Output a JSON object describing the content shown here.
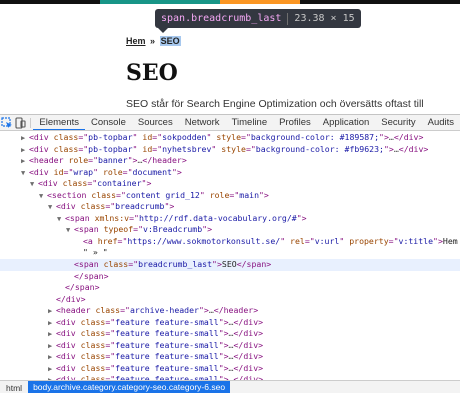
{
  "colors": {
    "topbar_podden": "#189587",
    "topbar_nyhetsbrev": "#fb9623",
    "selection": "#a7c8ee",
    "accent": "#1a73e8"
  },
  "tooltip": {
    "selector": "span.breadcrumb_last",
    "dims": "23.38 × 15"
  },
  "page": {
    "breadcrumb_home": "Hem",
    "breadcrumb_sep": "»",
    "breadcrumb_last": "SEO",
    "heading": "SEO",
    "intro": "SEO står för Search Engine Optimization och översätts oftast till"
  },
  "devtools": {
    "toolbar_icons": [
      "inspect-element-icon",
      "device-toolbar-icon"
    ],
    "tabs": [
      "Elements",
      "Console",
      "Sources",
      "Network",
      "Timeline",
      "Profiles",
      "Application",
      "Security",
      "Audits"
    ],
    "active_tab": "Elements",
    "dom_rows": [
      {
        "indent": 1,
        "tri": "▶",
        "tokens": [
          [
            "tag",
            "<div "
          ],
          [
            "attr",
            "class"
          ],
          [
            "tag",
            "=\""
          ],
          [
            "val",
            "pb-topbar"
          ],
          [
            "tag",
            "\" "
          ],
          [
            "attr",
            "id"
          ],
          [
            "tag",
            "=\""
          ],
          [
            "val",
            "sokpodden"
          ],
          [
            "tag",
            "\" "
          ],
          [
            "attr",
            "style"
          ],
          [
            "tag",
            "=\""
          ],
          [
            "val",
            "background-color: #189587;"
          ],
          [
            "tag",
            "\">"
          ],
          [
            "ell",
            "…"
          ],
          [
            "tag",
            "</div>"
          ]
        ]
      },
      {
        "indent": 1,
        "tri": "▶",
        "tokens": [
          [
            "tag",
            "<div "
          ],
          [
            "attr",
            "class"
          ],
          [
            "tag",
            "=\""
          ],
          [
            "val",
            "pb-topbar"
          ],
          [
            "tag",
            "\" "
          ],
          [
            "attr",
            "id"
          ],
          [
            "tag",
            "=\""
          ],
          [
            "val",
            "nyhetsbrev"
          ],
          [
            "tag",
            "\" "
          ],
          [
            "attr",
            "style"
          ],
          [
            "tag",
            "=\""
          ],
          [
            "val",
            "background-color: #fb9623;"
          ],
          [
            "tag",
            "\">"
          ],
          [
            "ell",
            "…"
          ],
          [
            "tag",
            "</div>"
          ]
        ]
      },
      {
        "indent": 1,
        "tri": "▶",
        "tokens": [
          [
            "tag",
            "<header "
          ],
          [
            "attr",
            "role"
          ],
          [
            "tag",
            "=\""
          ],
          [
            "val",
            "banner"
          ],
          [
            "tag",
            "\">"
          ],
          [
            "ell",
            "…"
          ],
          [
            "tag",
            "</header>"
          ]
        ]
      },
      {
        "indent": 1,
        "tri": "▼",
        "tokens": [
          [
            "tag",
            "<div "
          ],
          [
            "attr",
            "id"
          ],
          [
            "tag",
            "=\""
          ],
          [
            "val",
            "wrap"
          ],
          [
            "tag",
            "\" "
          ],
          [
            "attr",
            "role"
          ],
          [
            "tag",
            "=\""
          ],
          [
            "val",
            "document"
          ],
          [
            "tag",
            "\">"
          ]
        ]
      },
      {
        "indent": 2,
        "tri": "▼",
        "tokens": [
          [
            "tag",
            "<div "
          ],
          [
            "attr",
            "class"
          ],
          [
            "tag",
            "=\""
          ],
          [
            "val",
            "container"
          ],
          [
            "tag",
            "\">"
          ]
        ]
      },
      {
        "indent": 3,
        "tri": "▼",
        "tokens": [
          [
            "tag",
            "<section "
          ],
          [
            "attr",
            "class"
          ],
          [
            "tag",
            "=\""
          ],
          [
            "val",
            "content grid_12"
          ],
          [
            "tag",
            "\" "
          ],
          [
            "attr",
            "role"
          ],
          [
            "tag",
            "=\""
          ],
          [
            "val",
            "main"
          ],
          [
            "tag",
            "\">"
          ]
        ]
      },
      {
        "indent": 4,
        "tri": "▼",
        "tokens": [
          [
            "tag",
            "<div "
          ],
          [
            "attr",
            "class"
          ],
          [
            "tag",
            "=\""
          ],
          [
            "val",
            "breadcrumb"
          ],
          [
            "tag",
            "\">"
          ]
        ]
      },
      {
        "indent": 5,
        "tri": "▼",
        "tokens": [
          [
            "tag",
            "<span "
          ],
          [
            "attr",
            "xmlns:v"
          ],
          [
            "tag",
            "=\""
          ],
          [
            "val",
            "http://rdf.data-vocabulary.org/#"
          ],
          [
            "tag",
            "\">"
          ]
        ]
      },
      {
        "indent": 6,
        "tri": "▼",
        "tokens": [
          [
            "tag",
            "<span "
          ],
          [
            "attr",
            "typeof"
          ],
          [
            "tag",
            "=\""
          ],
          [
            "val",
            "v:Breadcrumb"
          ],
          [
            "tag",
            "\">"
          ]
        ]
      },
      {
        "indent": 7,
        "tri": "",
        "tokens": [
          [
            "tag",
            "<a "
          ],
          [
            "attr",
            "href"
          ],
          [
            "tag",
            "=\""
          ],
          [
            "val",
            "https://www.sokmotorkonsult.se/"
          ],
          [
            "tag",
            "\" "
          ],
          [
            "attr",
            "rel"
          ],
          [
            "tag",
            "=\""
          ],
          [
            "val",
            "v:url"
          ],
          [
            "tag",
            "\" "
          ],
          [
            "attr",
            "property"
          ],
          [
            "tag",
            "=\""
          ],
          [
            "val",
            "v:title"
          ],
          [
            "tag",
            "\">"
          ],
          [
            "txt",
            "Hem"
          ]
        ]
      },
      {
        "indent": 7,
        "tri": "",
        "tokens": [
          [
            "txt",
            "\" » \""
          ]
        ]
      },
      {
        "indent": 6,
        "tri": "",
        "selected": true,
        "tokens": [
          [
            "tag",
            "<span "
          ],
          [
            "attr",
            "class"
          ],
          [
            "tag",
            "=\""
          ],
          [
            "val",
            "breadcrumb_last"
          ],
          [
            "tag",
            "\">"
          ],
          [
            "txt",
            "SEO"
          ],
          [
            "tag",
            "</span>"
          ]
        ]
      },
      {
        "indent": 6,
        "tri": "",
        "tokens": [
          [
            "tag",
            "</span>"
          ]
        ]
      },
      {
        "indent": 5,
        "tri": "",
        "tokens": [
          [
            "tag",
            "</span>"
          ]
        ]
      },
      {
        "indent": 4,
        "tri": "",
        "tokens": [
          [
            "tag",
            "</div>"
          ]
        ]
      },
      {
        "indent": 4,
        "tri": "▶",
        "tokens": [
          [
            "tag",
            "<header "
          ],
          [
            "attr",
            "class"
          ],
          [
            "tag",
            "=\""
          ],
          [
            "val",
            "archive-header"
          ],
          [
            "tag",
            "\">"
          ],
          [
            "ell",
            "…"
          ],
          [
            "tag",
            "</header>"
          ]
        ]
      },
      {
        "indent": 4,
        "tri": "▶",
        "tokens": [
          [
            "tag",
            "<div "
          ],
          [
            "attr",
            "class"
          ],
          [
            "tag",
            "=\""
          ],
          [
            "val",
            "feature feature-small"
          ],
          [
            "tag",
            "\">"
          ],
          [
            "ell",
            "…"
          ],
          [
            "tag",
            "</div>"
          ]
        ]
      },
      {
        "indent": 4,
        "tri": "▶",
        "tokens": [
          [
            "tag",
            "<div "
          ],
          [
            "attr",
            "class"
          ],
          [
            "tag",
            "=\""
          ],
          [
            "val",
            "feature feature-small"
          ],
          [
            "tag",
            "\">"
          ],
          [
            "ell",
            "…"
          ],
          [
            "tag",
            "</div>"
          ]
        ]
      },
      {
        "indent": 4,
        "tri": "▶",
        "tokens": [
          [
            "tag",
            "<div "
          ],
          [
            "attr",
            "class"
          ],
          [
            "tag",
            "=\""
          ],
          [
            "val",
            "feature feature-small"
          ],
          [
            "tag",
            "\">"
          ],
          [
            "ell",
            "…"
          ],
          [
            "tag",
            "</div>"
          ]
        ]
      },
      {
        "indent": 4,
        "tri": "▶",
        "tokens": [
          [
            "tag",
            "<div "
          ],
          [
            "attr",
            "class"
          ],
          [
            "tag",
            "=\""
          ],
          [
            "val",
            "feature feature-small"
          ],
          [
            "tag",
            "\">"
          ],
          [
            "ell",
            "…"
          ],
          [
            "tag",
            "</div>"
          ]
        ]
      },
      {
        "indent": 4,
        "tri": "▶",
        "tokens": [
          [
            "tag",
            "<div "
          ],
          [
            "attr",
            "class"
          ],
          [
            "tag",
            "=\""
          ],
          [
            "val",
            "feature feature-small"
          ],
          [
            "tag",
            "\">"
          ],
          [
            "ell",
            "…"
          ],
          [
            "tag",
            "</div>"
          ]
        ]
      },
      {
        "indent": 4,
        "tri": "▶",
        "tokens": [
          [
            "tag",
            "<div "
          ],
          [
            "attr",
            "class"
          ],
          [
            "tag",
            "=\""
          ],
          [
            "val",
            "feature feature-small"
          ],
          [
            "tag",
            "\">"
          ],
          [
            "ell",
            "…"
          ],
          [
            "tag",
            "</div>"
          ]
        ]
      }
    ],
    "statusbar": {
      "html": "html",
      "body": "body.archive.category.category-seo.category-6.seo"
    }
  }
}
